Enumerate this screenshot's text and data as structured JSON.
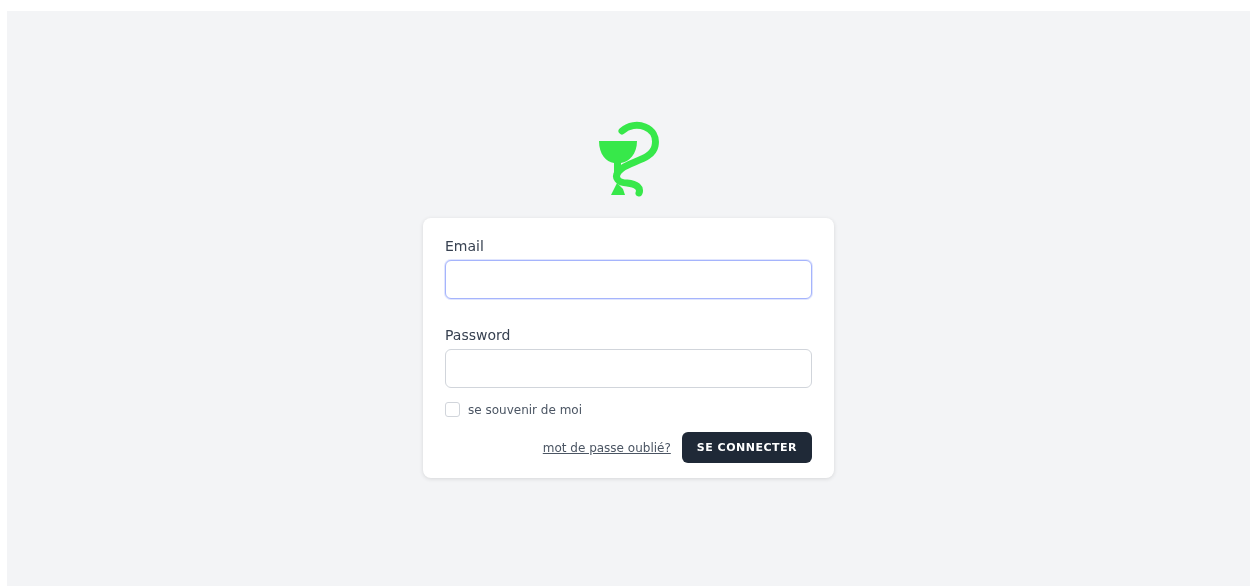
{
  "form": {
    "fields": [
      {
        "label": "Email",
        "focused": true
      },
      {
        "label": "Password",
        "focused": false
      }
    ],
    "remember": {
      "label": "se souvenir de moi",
      "checked": false
    },
    "forgot_link": "mot de passe oublié?",
    "submit": "SE CONNECTER"
  }
}
